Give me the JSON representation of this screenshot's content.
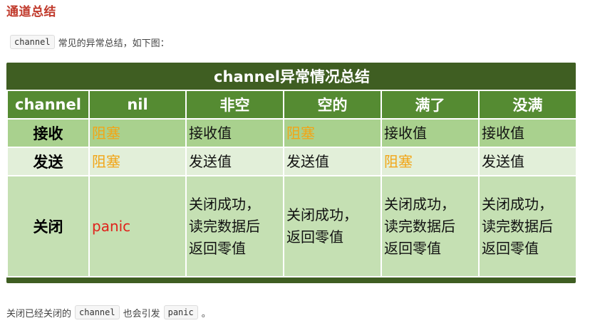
{
  "heading": "通道总结",
  "intro": {
    "code": "channel",
    "text": "常见的异常总结，如下图："
  },
  "table": {
    "title": "channel异常情况总结",
    "headers": [
      "channel",
      "nil",
      "非空",
      "空的",
      "满了",
      "没满"
    ],
    "rows": [
      {
        "label": "接收",
        "cells": [
          {
            "lines": [
              "阻塞"
            ],
            "color": "#f2a516"
          },
          {
            "lines": [
              "接收值"
            ],
            "color": "#111111"
          },
          {
            "lines": [
              "阻塞"
            ],
            "color": "#f2a516"
          },
          {
            "lines": [
              "接收值"
            ],
            "color": "#111111"
          },
          {
            "lines": [
              "接收值"
            ],
            "color": "#111111"
          }
        ]
      },
      {
        "label": "发送",
        "cells": [
          {
            "lines": [
              "阻塞"
            ],
            "color": "#f2a516"
          },
          {
            "lines": [
              "发送值"
            ],
            "color": "#111111"
          },
          {
            "lines": [
              "发送值"
            ],
            "color": "#111111"
          },
          {
            "lines": [
              "阻塞"
            ],
            "color": "#f2a516"
          },
          {
            "lines": [
              "发送值"
            ],
            "color": "#111111"
          }
        ]
      },
      {
        "label": "关闭",
        "cells": [
          {
            "lines": [
              "panic"
            ],
            "color": "#e0221b"
          },
          {
            "lines": [
              "关闭成功，",
              "读完数据后",
              "返回零值"
            ],
            "color": "#111111"
          },
          {
            "lines": [
              "关闭成功，",
              "返回零值"
            ],
            "color": "#111111"
          },
          {
            "lines": [
              "关闭成功，",
              "读完数据后",
              "返回零值"
            ],
            "color": "#111111"
          },
          {
            "lines": [
              "关闭成功，",
              "读完数据后",
              "返回零值"
            ],
            "color": "#111111"
          }
        ]
      }
    ]
  },
  "footer": {
    "text1": "关闭已经关闭的",
    "code1": "channel",
    "text2": "也会引发",
    "code2": "panic",
    "text3": "。"
  }
}
